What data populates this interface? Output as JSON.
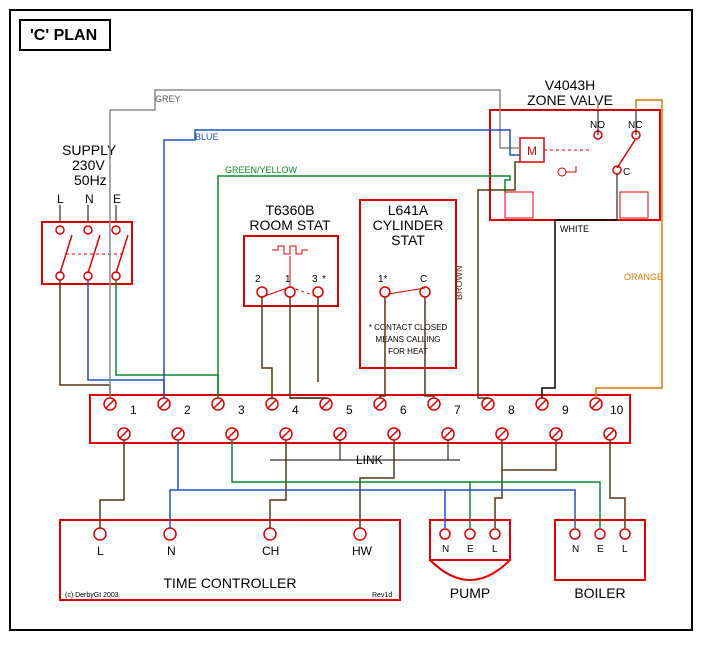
{
  "title": "'C' PLAN",
  "supply": {
    "label": "SUPPLY",
    "voltage": "230V",
    "freq": "50Hz",
    "L": "L",
    "N": "N",
    "E": "E"
  },
  "zone_valve": {
    "label": "ZONE VALVE",
    "model": "V4043H",
    "M": "M",
    "NO": "NO",
    "NC": "NC",
    "C": "C"
  },
  "room_stat": {
    "label": "ROOM STAT",
    "model": "T6360B",
    "t1": "1",
    "t2": "2",
    "t3": "3"
  },
  "cyl_stat": {
    "label": "CYLINDER",
    "label2": "STAT",
    "model": "L641A",
    "t1": "1",
    "tC": "C",
    "note1": "* CONTACT CLOSED",
    "note2": "MEANS CALLING",
    "note3": "FOR HEAT",
    "asterisk": "*",
    "one_ast": "1*"
  },
  "terminal_strip": {
    "t1": "1",
    "t2": "2",
    "t3": "3",
    "t4": "4",
    "t5": "5",
    "t6": "6",
    "t7": "7",
    "t8": "8",
    "t9": "9",
    "t10": "10",
    "link": "LINK"
  },
  "time_controller": {
    "label": "TIME CONTROLLER",
    "L": "L",
    "N": "N",
    "CH": "CH",
    "HW": "HW",
    "copyright": "(c) DerbyGt 2003",
    "rev": "Rev1d"
  },
  "pump": {
    "label": "PUMP",
    "N": "N",
    "E": "E",
    "L": "L"
  },
  "boiler": {
    "label": "BOILER",
    "N": "N",
    "E": "E",
    "L": "L"
  },
  "wires": {
    "grey": "GREY",
    "blue": "BLUE",
    "green_yellow": "GREEN/YELLOW",
    "brown": "BROWN",
    "white": "WHITE",
    "orange": "ORANGE"
  }
}
